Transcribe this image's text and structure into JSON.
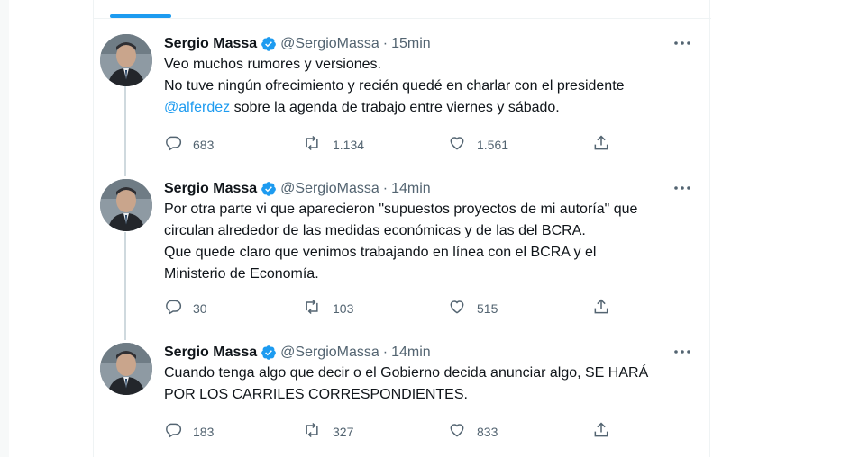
{
  "tweets": [
    {
      "author": {
        "name": "Sergio Massa",
        "handle": "@SergioMassa"
      },
      "separator": "·",
      "time": "15min",
      "text": {
        "line1": "Veo muchos rumores y versiones.",
        "line2": "No tuve ningún ofrecimiento y recién quedé en charlar con el presidente",
        "mention": "@alferdez",
        "line3_rest": " sobre la agenda de trabajo entre viernes y sábado."
      },
      "stats": {
        "replies": "683",
        "retweets": "1.134",
        "likes": "1.561"
      }
    },
    {
      "author": {
        "name": "Sergio Massa",
        "handle": "@SergioMassa"
      },
      "separator": "·",
      "time": "14min",
      "text": {
        "line1": "Por otra parte vi que aparecieron \"supuestos proyectos de mi autoría\" que",
        "line2": "circulan alrededor de las medidas económicas y de las del BCRA.",
        "line3": "Que quede claro que venimos trabajando en línea con el BCRA y el",
        "line4": "Ministerio de Economía."
      },
      "stats": {
        "replies": "30",
        "retweets": "103",
        "likes": "515"
      }
    },
    {
      "author": {
        "name": "Sergio Massa",
        "handle": "@SergioMassa"
      },
      "separator": "·",
      "time": "14min",
      "text": {
        "line1": "Cuando tenga algo que decir o el Gobierno decida anunciar algo, SE HARÁ",
        "line2": "POR LOS CARRILES CORRESPONDIENTES."
      },
      "stats": {
        "replies": "183",
        "retweets": "327",
        "likes": "833"
      }
    }
  ],
  "colors": {
    "accent": "#1d9bf0",
    "secondary_text": "#536471",
    "primary_text": "#0f1419"
  },
  "icons": [
    "verified-icon",
    "more-icon",
    "reply-icon",
    "retweet-icon",
    "like-icon",
    "share-icon"
  ]
}
